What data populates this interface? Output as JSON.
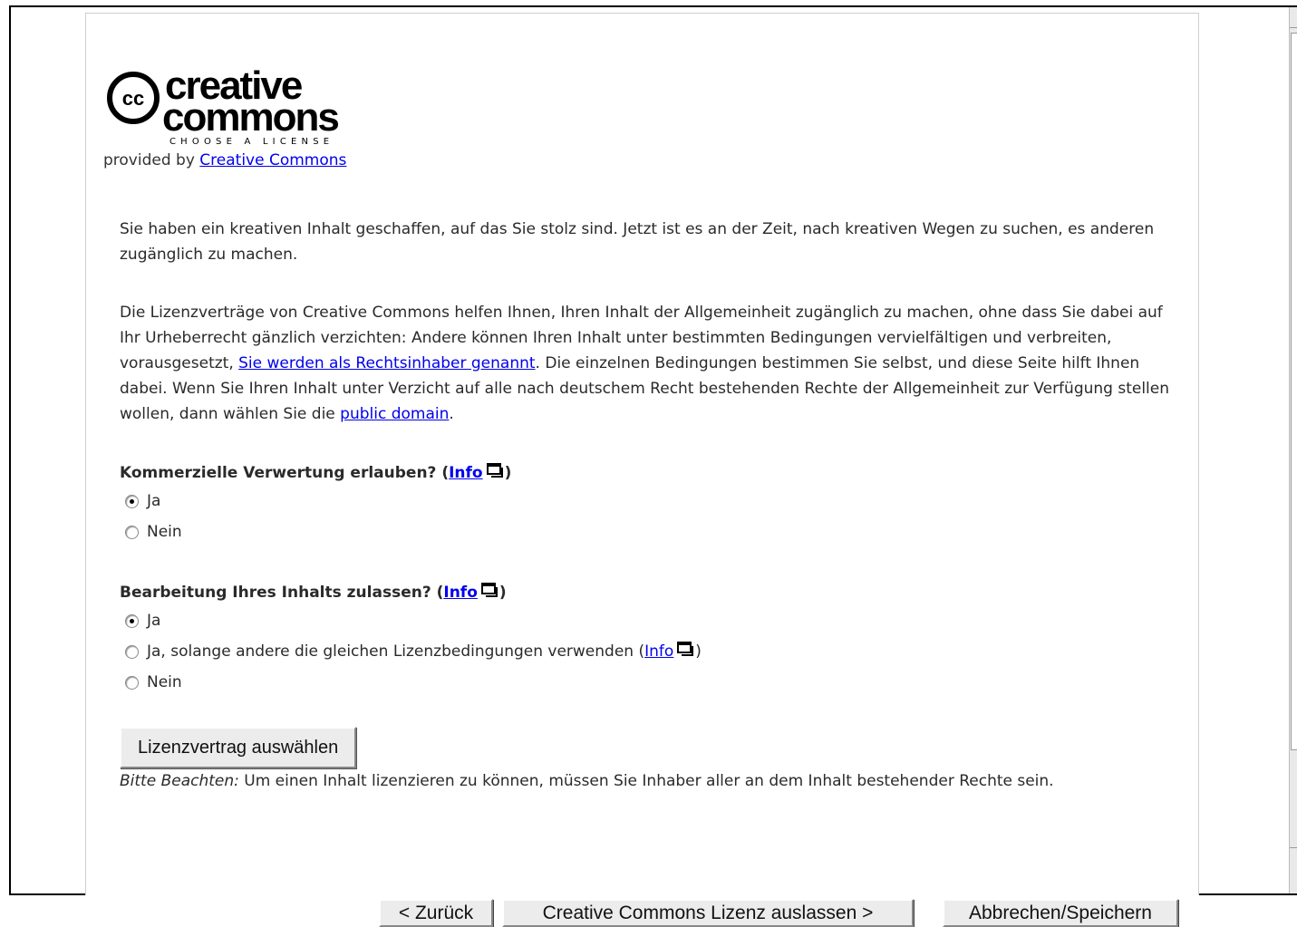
{
  "logo": {
    "line1": "creative",
    "line2": "commons",
    "tagline": "CHOOSE A LICENSE",
    "badge": "cc"
  },
  "provided": {
    "prefix": "provided by ",
    "link": "Creative Commons"
  },
  "intro": "Sie haben ein kreativen Inhalt geschaffen, auf das Sie stolz sind. Jetzt ist es an der Zeit, nach kreativen Wegen zu suchen, es anderen zugänglich zu machen.",
  "description": {
    "part1": "Die Lizenzverträge von Creative Commons helfen Ihnen, Ihren Inhalt der Allgemeinheit zugänglich zu machen, ohne dass Sie dabei auf Ihr Urheberrecht gänzlich verzichten: Andere können Ihren Inhalt unter bestimmten Bedingungen vervielfältigen und verbreiten, vorausgesetzt, ",
    "link1": "Sie werden als Rechtsinhaber genannt",
    "part2": ". Die einzelnen Bedingungen bestimmen Sie selbst, und diese Seite hilft Ihnen dabei. Wenn Sie Ihren Inhalt unter Verzicht auf alle nach deutschem Recht bestehenden Rechte der Allgemeinheit zur Verfügung stellen wollen, dann wählen Sie die ",
    "link2": "public domain",
    "part3": "."
  },
  "q1": {
    "label": "Kommerzielle Verwertung erlauben? (",
    "info": "Info",
    "close": ")",
    "options": [
      "Ja",
      "Nein"
    ],
    "selected": 0
  },
  "q2": {
    "label": "Bearbeitung Ihres Inhalts zulassen? (",
    "info": "Info",
    "close": ")",
    "options": [
      "Ja",
      "Ja, solange andere die gleichen Lizenzbedingungen verwenden (",
      "Nein"
    ],
    "option2_info": "Info",
    "option2_close": ")",
    "selected": 0
  },
  "submit": "Lizenzvertrag auswählen",
  "note": {
    "label": "Bitte Beachten:",
    "text": " Um einen Inhalt lizenzieren zu können, müssen Sie Inhaber aller an dem Inhalt bestehender Rechte sein."
  },
  "nav": {
    "back": "< Zurück",
    "skip": "Creative Commons Lizenz auslassen  >",
    "cancel": "Abbrechen/Speichern"
  }
}
